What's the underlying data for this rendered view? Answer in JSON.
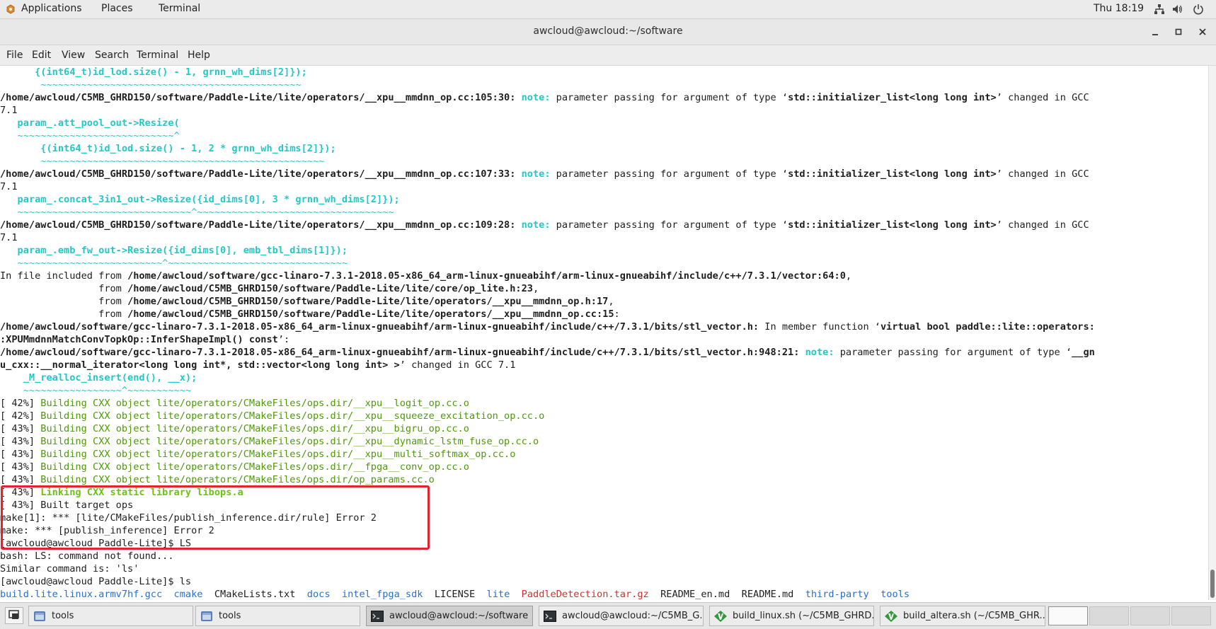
{
  "top_panel": {
    "applications": "Applications",
    "places": "Places",
    "terminal": "Terminal",
    "clock": "Thu 18:19",
    "tray_icons": [
      "network-icon",
      "volume-icon",
      "power-icon"
    ]
  },
  "window": {
    "title": "awcloud@awcloud:~/software",
    "controls": [
      "minimize-icon",
      "maximize-icon",
      "close-icon"
    ]
  },
  "menubar": [
    "File",
    "Edit",
    "View",
    "Search",
    "Terminal",
    "Help"
  ],
  "colors": {
    "highlight_box": "#e4242c",
    "note": "#22c7c7",
    "build": "#4e9a06",
    "dir": "#2a6fd1",
    "archive": "#d62d2d"
  },
  "terminal_lines": [
    [
      [
        "cyb",
        "      {(int64_t)id_lod.size() - 1, grnn_wh_dims[2]});"
      ]
    ],
    [
      [
        "cy",
        "       ~~~~~~~~~~~~~~~~~~~~~~~~~~~~~~~~~~~~~~~~~~~~~"
      ]
    ],
    [
      [
        "b",
        "/home/awcloud/C5MB_GHRD150/software/Paddle-Lite/lite/operators/__xpu__mmdnn_op.cc:105:30:"
      ],
      [
        "",
        " "
      ],
      [
        "cyb",
        "note:"
      ],
      [
        "",
        " parameter passing for argument of type ‘"
      ],
      [
        "b",
        "std::initializer_list<long long int>"
      ],
      [
        "",
        "’ changed in GCC"
      ]
    ],
    [
      [
        "",
        "7.1"
      ]
    ],
    [
      [
        "cyb",
        "   param_.att_pool_out->Resize("
      ]
    ],
    [
      [
        "cy",
        "   ~~~~~~~~~~~~~~~~~~~~~~~~~~~^"
      ]
    ],
    [
      [
        "cyb",
        "       {(int64_t)id_lod.size() - 1, 2 * grnn_wh_dims[2]});"
      ]
    ],
    [
      [
        "cy",
        "       ~~~~~~~~~~~~~~~~~~~~~~~~~~~~~~~~~~~~~~~~~~~~~~~~~"
      ]
    ],
    [
      [
        "b",
        "/home/awcloud/C5MB_GHRD150/software/Paddle-Lite/lite/operators/__xpu__mmdnn_op.cc:107:33:"
      ],
      [
        "",
        " "
      ],
      [
        "cyb",
        "note:"
      ],
      [
        "",
        " parameter passing for argument of type ‘"
      ],
      [
        "b",
        "std::initializer_list<long long int>"
      ],
      [
        "",
        "’ changed in GCC"
      ]
    ],
    [
      [
        "",
        "7.1"
      ]
    ],
    [
      [
        "cyb",
        "   param_.concat_3in1_out->Resize({id_dims[0], 3 * grnn_wh_dims[2]});"
      ]
    ],
    [
      [
        "cy",
        "   ~~~~~~~~~~~~~~~~~~~~~~~~~~~~~~^~~~~~~~~~~~~~~~~~~~~~~~~~~~~~~~~~~"
      ]
    ],
    [
      [
        "b",
        "/home/awcloud/C5MB_GHRD150/software/Paddle-Lite/lite/operators/__xpu__mmdnn_op.cc:109:28:"
      ],
      [
        "",
        " "
      ],
      [
        "cyb",
        "note:"
      ],
      [
        "",
        " parameter passing for argument of type ‘"
      ],
      [
        "b",
        "std::initializer_list<long long int>"
      ],
      [
        "",
        "’ changed in GCC"
      ]
    ],
    [
      [
        "",
        "7.1"
      ]
    ],
    [
      [
        "cyb",
        "   param_.emb_fw_out->Resize({id_dims[0], emb_tbl_dims[1]});"
      ]
    ],
    [
      [
        "cy",
        "   ~~~~~~~~~~~~~~~~~~~~~~~~~^~~~~~~~~~~~~~~~~~~~~~~~~~~~~~~~"
      ]
    ],
    [
      [
        "",
        "In file included from "
      ],
      [
        "b",
        "/home/awcloud/software/gcc-linaro-7.3.1-2018.05-x86_64_arm-linux-gnueabihf/arm-linux-gnueabihf/include/c++/7.3.1/vector:64:0"
      ],
      [
        "",
        ","
      ]
    ],
    [
      [
        "",
        "                 from "
      ],
      [
        "b",
        "/home/awcloud/C5MB_GHRD150/software/Paddle-Lite/lite/core/op_lite.h:23"
      ],
      [
        "",
        ","
      ]
    ],
    [
      [
        "",
        "                 from "
      ],
      [
        "b",
        "/home/awcloud/C5MB_GHRD150/software/Paddle-Lite/lite/operators/__xpu__mmdnn_op.h:17"
      ],
      [
        "",
        ","
      ]
    ],
    [
      [
        "",
        "                 from "
      ],
      [
        "b",
        "/home/awcloud/C5MB_GHRD150/software/Paddle-Lite/lite/operators/__xpu__mmdnn_op.cc:15"
      ],
      [
        "",
        ":"
      ]
    ],
    [
      [
        "b",
        "/home/awcloud/software/gcc-linaro-7.3.1-2018.05-x86_64_arm-linux-gnueabihf/arm-linux-gnueabihf/include/c++/7.3.1/bits/stl_vector.h:"
      ],
      [
        "",
        " In member function ‘"
      ],
      [
        "b",
        "virtual bool paddle::lite::operators:"
      ]
    ],
    [
      [
        "b",
        ":XPUMmdnnMatchConvTopkOp::InferShapeImpl() const"
      ],
      [
        "",
        "’:"
      ]
    ],
    [
      [
        "b",
        "/home/awcloud/software/gcc-linaro-7.3.1-2018.05-x86_64_arm-linux-gnueabihf/arm-linux-gnueabihf/include/c++/7.3.1/bits/stl_vector.h:948:21:"
      ],
      [
        "",
        " "
      ],
      [
        "cyb",
        "note:"
      ],
      [
        "",
        " parameter passing for argument of type ‘"
      ],
      [
        "b",
        "__gn"
      ]
    ],
    [
      [
        "b",
        "u_cxx::__normal_iterator<long long int*, std::vector<long long int> >"
      ],
      [
        "",
        "’ changed in GCC 7.1"
      ]
    ],
    [
      [
        "cyb",
        "    _M_realloc_insert(end(), __x);"
      ]
    ],
    [
      [
        "cy",
        "    ~~~~~~~~~~~~~~~~~^~~~~~~~~~~~"
      ]
    ],
    [
      [
        "",
        "[ 42%] "
      ],
      [
        "gr",
        "Building CXX object lite/operators/CMakeFiles/ops.dir/__xpu__logit_op.cc.o"
      ]
    ],
    [
      [
        "",
        "[ 42%] "
      ],
      [
        "gr",
        "Building CXX object lite/operators/CMakeFiles/ops.dir/__xpu__squeeze_excitation_op.cc.o"
      ]
    ],
    [
      [
        "",
        "[ 43%] "
      ],
      [
        "gr",
        "Building CXX object lite/operators/CMakeFiles/ops.dir/__xpu__bigru_op.cc.o"
      ]
    ],
    [
      [
        "",
        "[ 43%] "
      ],
      [
        "gr",
        "Building CXX object lite/operators/CMakeFiles/ops.dir/__xpu__dynamic_lstm_fuse_op.cc.o"
      ]
    ],
    [
      [
        "",
        "[ 43%] "
      ],
      [
        "gr",
        "Building CXX object lite/operators/CMakeFiles/ops.dir/__xpu__multi_softmax_op.cc.o"
      ]
    ],
    [
      [
        "",
        "[ 43%] "
      ],
      [
        "gr",
        "Building CXX object lite/operators/CMakeFiles/ops.dir/__fpga__conv_op.cc.o"
      ]
    ],
    [
      [
        "",
        "[ 43%] "
      ],
      [
        "gr",
        "Building CXX object lite/operators/CMakeFiles/ops.dir/op_params.cc.o"
      ]
    ],
    [
      [
        "",
        "[ 43%] "
      ],
      [
        "grb",
        "Linking CXX static library libops.a"
      ]
    ],
    [
      [
        "",
        "[ 43%] Built target ops"
      ]
    ],
    [
      [
        "",
        "make[1]: *** [lite/CMakeFiles/publish_inference.dir/rule] Error 2"
      ]
    ],
    [
      [
        "",
        "make: *** [publish_inference] Error 2"
      ]
    ],
    [
      [
        "",
        "[awcloud@awcloud Paddle-Lite]$ LS"
      ]
    ],
    [
      [
        "",
        "bash: LS: command not found..."
      ]
    ],
    [
      [
        "",
        "Similar command is: 'ls'"
      ]
    ],
    [
      [
        "",
        "[awcloud@awcloud Paddle-Lite]$ ls"
      ]
    ],
    [
      [
        "bl",
        "build.lite.linux.armv7hf.gcc"
      ],
      [
        "",
        "  "
      ],
      [
        "bl",
        "cmake"
      ],
      [
        "",
        "  CMakeLists.txt  "
      ],
      [
        "bl",
        "docs"
      ],
      [
        "",
        "  "
      ],
      [
        "bl",
        "intel_fpga_sdk"
      ],
      [
        "",
        "  LICENSE  "
      ],
      [
        "bl",
        "lite"
      ],
      [
        "",
        "  "
      ],
      [
        "rd",
        "PaddleDetection.tar.gz"
      ],
      [
        "",
        "  README_en.md  README.md  "
      ],
      [
        "bl",
        "third-party"
      ],
      [
        "",
        "  "
      ],
      [
        "bl",
        "tools"
      ]
    ]
  ],
  "taskbar": {
    "tasks": [
      {
        "label": "tools",
        "icon": "file-manager-icon",
        "active": false
      },
      {
        "label": "tools",
        "icon": "file-manager-icon",
        "active": false
      },
      {
        "label": "awcloud@awcloud:~/software",
        "icon": "terminal-icon",
        "active": true
      },
      {
        "label": "awcloud@awcloud:~/C5MB_G...",
        "icon": "terminal-icon",
        "active": false
      },
      {
        "label": "build_linux.sh (~/C5MB_GHRD...",
        "icon": "vim-icon",
        "active": false
      },
      {
        "label": "build_altera.sh (~/C5MB_GHR...",
        "icon": "vim-icon",
        "active": false
      }
    ],
    "workspaces": 4,
    "active_workspace": 1
  }
}
